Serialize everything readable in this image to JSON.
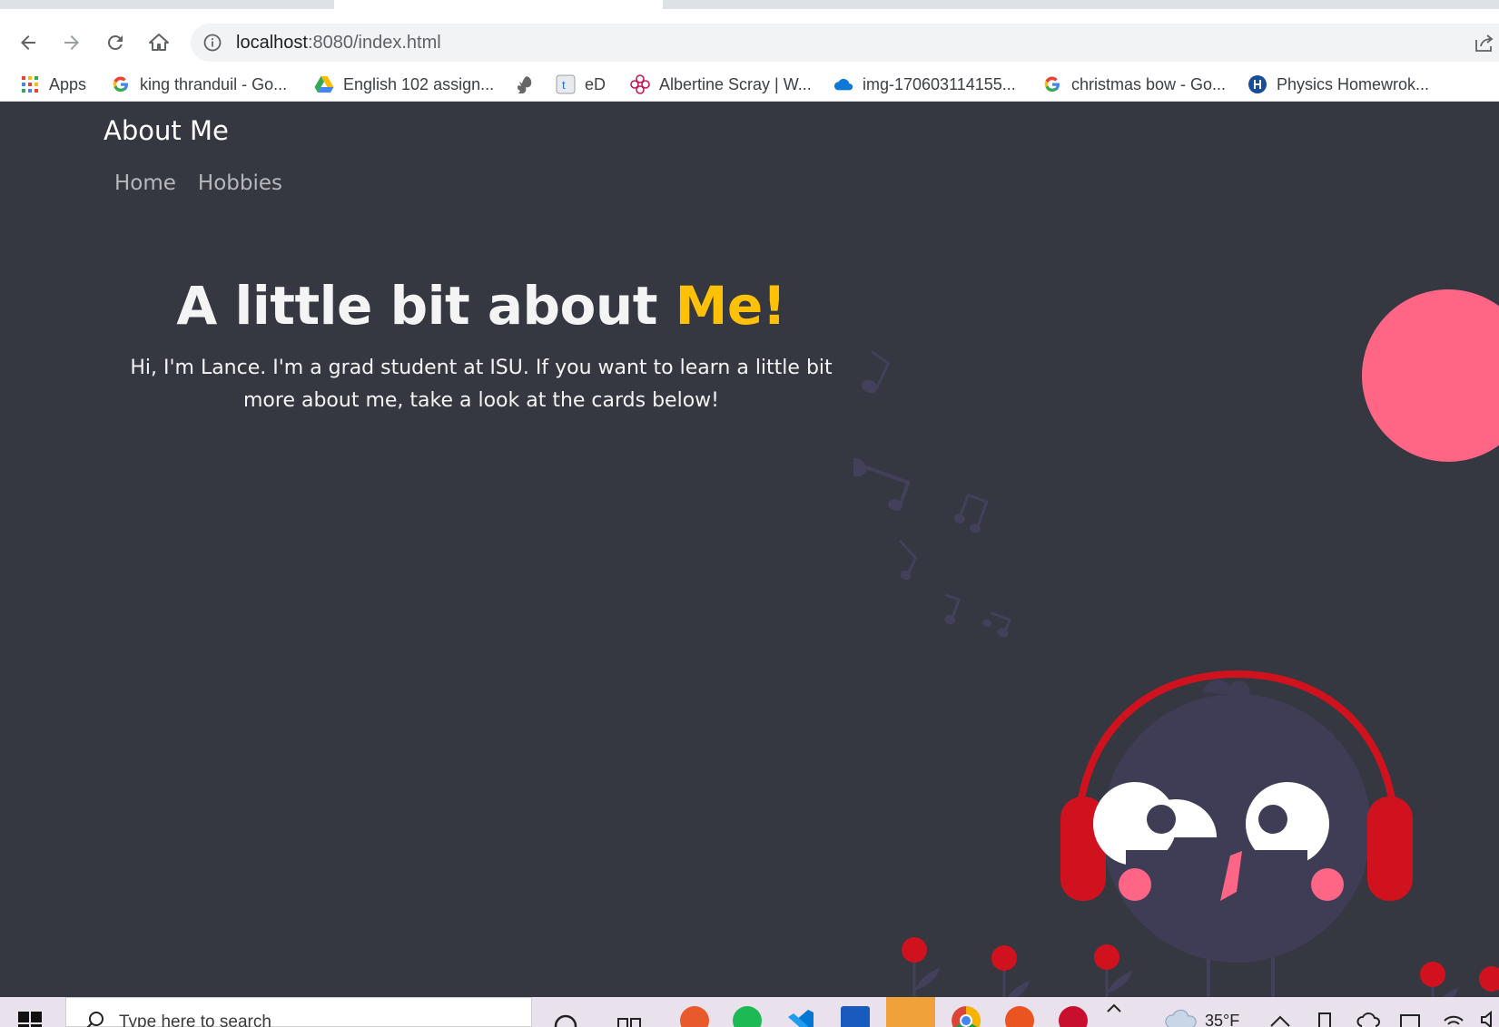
{
  "browser": {
    "url_host": "localhost",
    "url_path": ":8080/index.html",
    "bookmarks": [
      {
        "label": "Apps",
        "icon": "apps-grid-icon"
      },
      {
        "label": "king thranduil - Go...",
        "icon": "google-icon"
      },
      {
        "label": "English 102 assign...",
        "icon": "google-drive-icon"
      },
      {
        "label": "",
        "icon": "squirrel-icon"
      },
      {
        "label": "eD",
        "icon": "t-icon"
      },
      {
        "label": "Albertine Scray | W...",
        "icon": "flower-icon"
      },
      {
        "label": "img-170603114155...",
        "icon": "onedrive-icon"
      },
      {
        "label": "christmas bow - Go...",
        "icon": "google-icon"
      },
      {
        "label": "Physics Homewrok...",
        "icon": "university-icon"
      }
    ]
  },
  "page": {
    "brand": "About Me",
    "nav": [
      "Home",
      "Hobbies"
    ],
    "hero": {
      "title_main": "A little bit about ",
      "title_accent": "Me!",
      "text": "Hi, I'm Lance. I'm a grad student at ISU. If you want to learn a little bit more about me, take a look at the cards below!"
    },
    "colors": {
      "background": "#353840",
      "accent": "#ffc107",
      "text": "#f4f4f4",
      "nav": "#b6b8bc"
    }
  },
  "taskbar": {
    "search_placeholder": "Type here to search",
    "weather": "35°F"
  }
}
